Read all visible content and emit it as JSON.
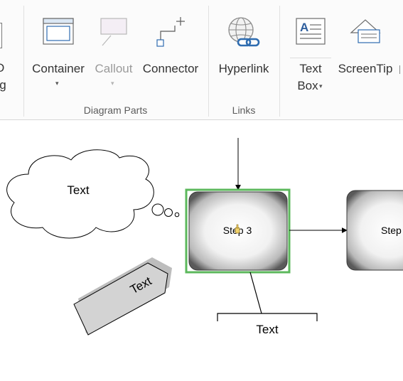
{
  "ribbon": {
    "partial_left": {
      "line1": "D",
      "line2": "ing"
    },
    "diagram_parts": {
      "label": "Diagram Parts",
      "container": {
        "label": "Container",
        "caret": "▾"
      },
      "callout": {
        "label": "Callout",
        "caret": "▾",
        "disabled": true
      },
      "connector": {
        "label": "Connector"
      }
    },
    "links": {
      "label": "Links",
      "hyperlink": {
        "label": "Hyperlink"
      }
    },
    "text_group": {
      "text_box": {
        "line1": "Text",
        "line2": "Box",
        "caret": "▾"
      },
      "screentip": {
        "label": "ScreenTip"
      }
    }
  },
  "canvas": {
    "cloud_text": "Text",
    "arrow_shape_text": "Text",
    "process_box_1": "Step 3",
    "process_box_2": "Step",
    "annotation_text": "Text"
  },
  "colors": {
    "selection": "#5cb85c",
    "hyperlink_globe": "#8a8a8a",
    "hyperlink_chain": "#2e6cb0",
    "textbox_letter": "#2f5f9e",
    "arrow_shape_fill": "#d3d3d3"
  }
}
